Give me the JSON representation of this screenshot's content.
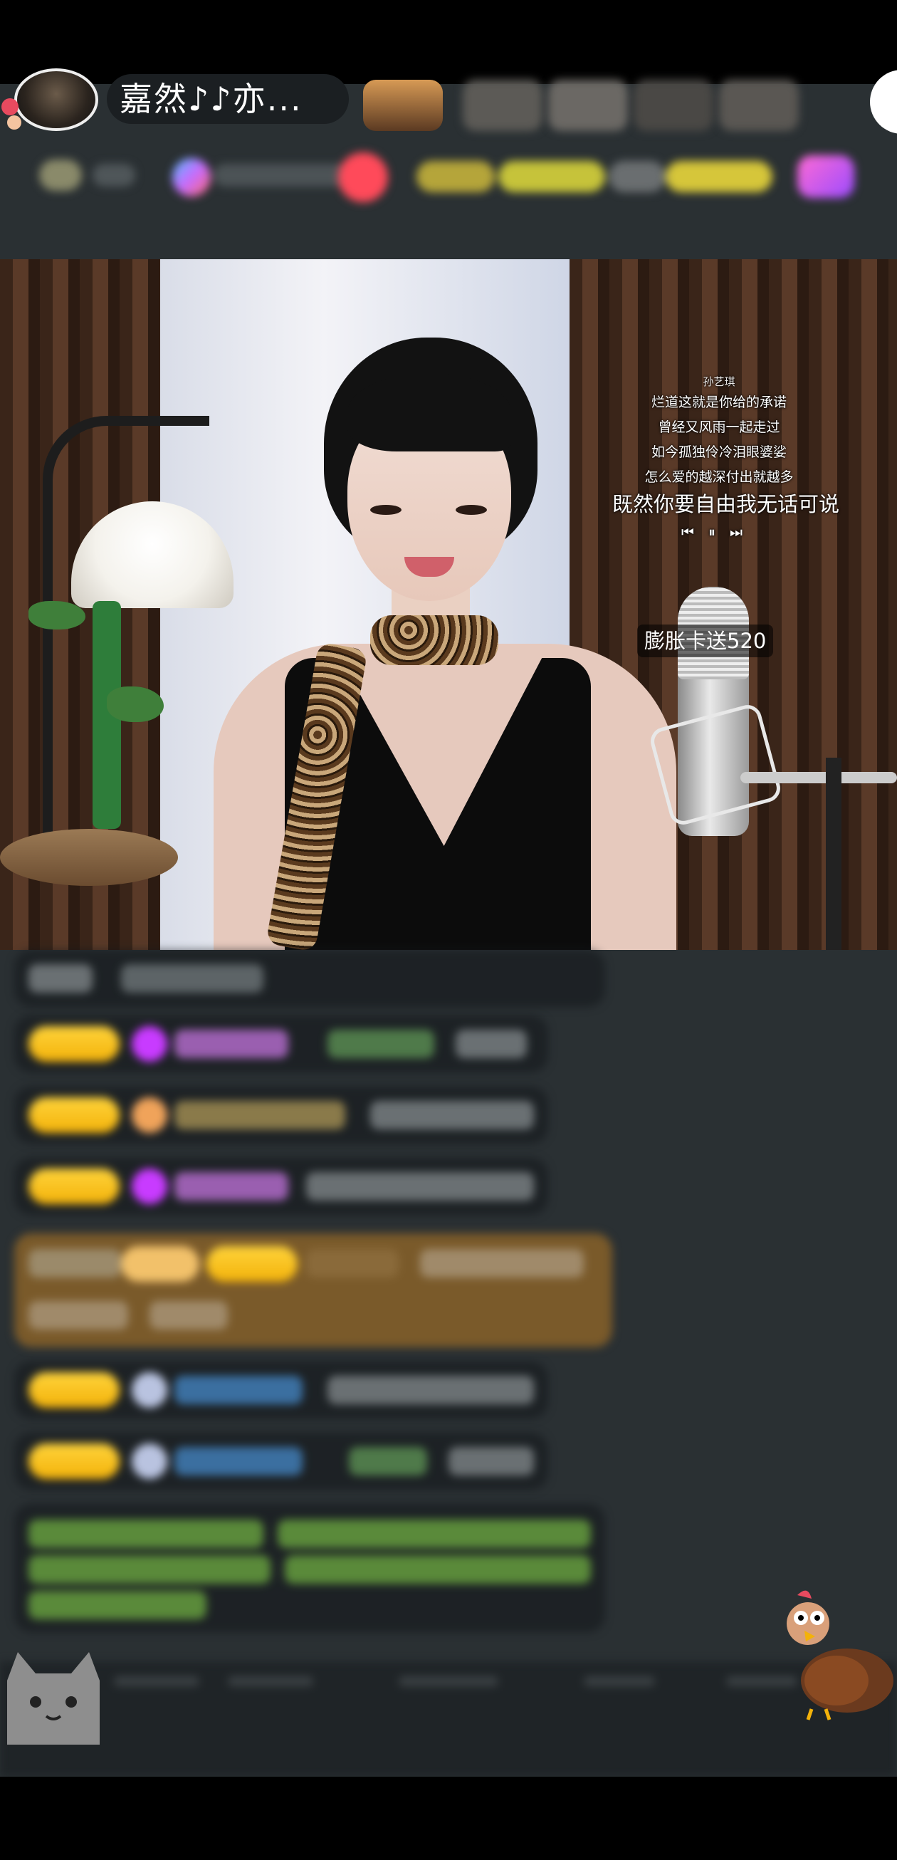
{
  "header": {
    "streamer_name": "嘉然♪♪亦...",
    "avatar_icon": "streamer-avatar",
    "viewer_avatars": [
      "viewer-avatar-1",
      "viewer-avatar-2",
      "viewer-avatar-3",
      "viewer-avatar-4",
      "viewer-avatar-5"
    ]
  },
  "stream": {
    "lyrics": {
      "title": "孙艺琪",
      "lines": [
        "烂道这就是你给的承诺",
        "曾经又风雨一起走过",
        "如今孤独伶冷泪眼婆娑",
        "怎么爱的越深付出就越多"
      ],
      "highlight_line": "既然你要自由我无话可说",
      "player_controls": [
        "⏮",
        "⏸",
        "⏭"
      ]
    },
    "promo_text": "膨胀卡送520"
  },
  "colors": {
    "badge_gold": "#f3b20a",
    "gem_purple": "#c83bff",
    "chat_highlight": "#7a5a2a",
    "chat_green": "#5a8a3a",
    "app_bg": "#2a3033"
  }
}
